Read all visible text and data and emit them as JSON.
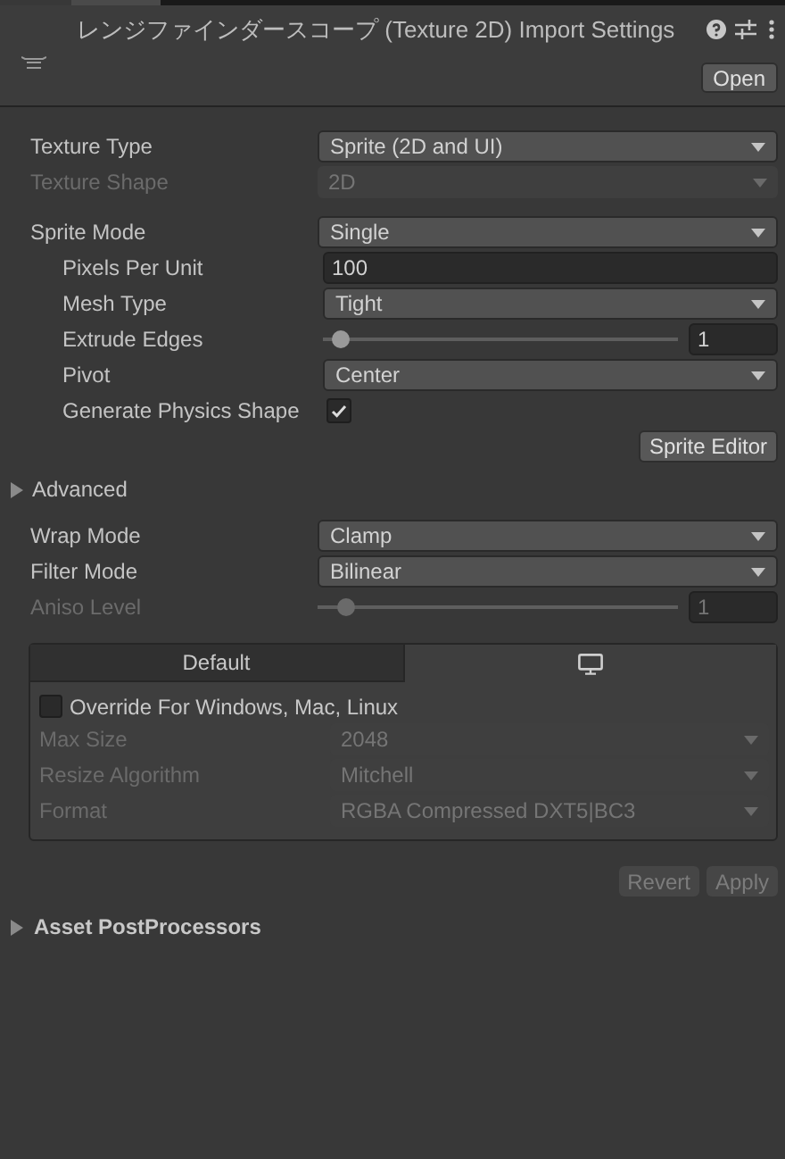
{
  "header": {
    "title": "レンジファインダースコープ (Texture 2D) Import Settings",
    "open_button": "Open"
  },
  "sections": [
    [
      {
        "kind": "dropdown",
        "label": "Texture Type",
        "value": "Sprite (2D and UI)",
        "disabled": false
      },
      {
        "kind": "dropdown",
        "label": "Texture Shape",
        "value": "2D",
        "disabled": true
      }
    ],
    [
      {
        "kind": "dropdown",
        "label": "Sprite Mode",
        "value": "Single",
        "disabled": false,
        "children": [
          {
            "kind": "number",
            "label": "Pixels Per Unit",
            "value": "100",
            "disabled": false
          },
          {
            "kind": "dropdown",
            "label": "Mesh Type",
            "value": "Tight",
            "disabled": false
          },
          {
            "kind": "slider",
            "label": "Extrude Edges",
            "value": "1",
            "level": 0.05,
            "disabled": false
          },
          {
            "kind": "dropdown",
            "label": "Pivot",
            "value": "Center",
            "disabled": false
          },
          {
            "kind": "checkbox",
            "label": "Generate Physics Shape",
            "checked": true
          }
        ]
      }
    ]
  ],
  "sprite_editor_button": "Sprite Editor",
  "advanced": {
    "label": "Advanced",
    "expanded": false
  },
  "sections2": [
    {
      "kind": "dropdown",
      "label": "Wrap Mode",
      "value": "Clamp",
      "disabled": false
    },
    {
      "kind": "dropdown",
      "label": "Filter Mode",
      "value": "Bilinear",
      "disabled": false
    },
    {
      "kind": "slider",
      "label": "Aniso Level",
      "value": "1",
      "level": 0.08,
      "disabled": true
    }
  ],
  "platform_tabs": [
    {
      "kind": "text",
      "label": "Default",
      "selected": false
    },
    {
      "kind": "monitor",
      "selected": true
    }
  ],
  "override": {
    "label": "Override For Windows, Mac, Linux",
    "checked": false
  },
  "platform_rows": [
    {
      "kind": "dropdown",
      "label": "Max Size",
      "value": "2048",
      "disabled": true
    },
    {
      "kind": "dropdown",
      "label": "Resize Algorithm",
      "value": "Mitchell",
      "disabled": true
    },
    {
      "kind": "dropdown",
      "label": "Format",
      "value": "RGBA Compressed DXT5|BC3",
      "disabled": true
    }
  ],
  "buttons": [
    {
      "label": "Revert",
      "disabled": true
    },
    {
      "label": "Apply",
      "disabled": true
    }
  ],
  "postprocessors": {
    "label": "Asset PostProcessors",
    "expanded": false
  }
}
